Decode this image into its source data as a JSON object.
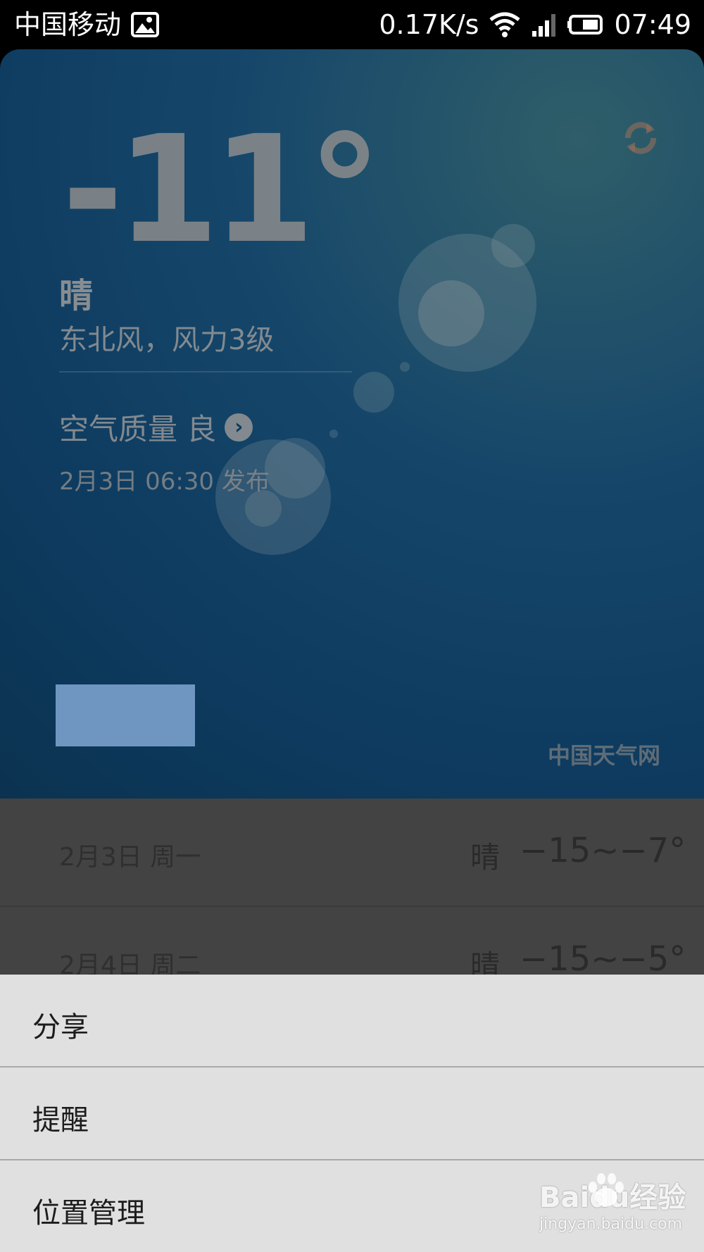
{
  "status_bar": {
    "carrier": "中国移动",
    "speed": "0.17K/s",
    "time": "07:49"
  },
  "weather": {
    "temperature": "-11°",
    "condition": "晴",
    "wind": "东北风，风力3级",
    "air_quality": "空气质量 良",
    "publish_time": "2月3日 06:30 发布",
    "source": "中国天气网"
  },
  "forecast": [
    {
      "date": "2月3日 周一",
      "condition": "晴",
      "temp": "−15~−7°"
    },
    {
      "date": "2月4日 周二",
      "condition": "晴",
      "temp": "−15~−5°"
    }
  ],
  "menu": {
    "items": [
      "分享",
      "提醒",
      "位置管理"
    ]
  },
  "watermark": {
    "logo": "Baidu经验",
    "url": "jingyan.baidu.com"
  },
  "colors": {
    "card_bg": "#0d3a5e",
    "blue_rect": "#6f95c1",
    "menu_bg": "#e0e0e0"
  }
}
